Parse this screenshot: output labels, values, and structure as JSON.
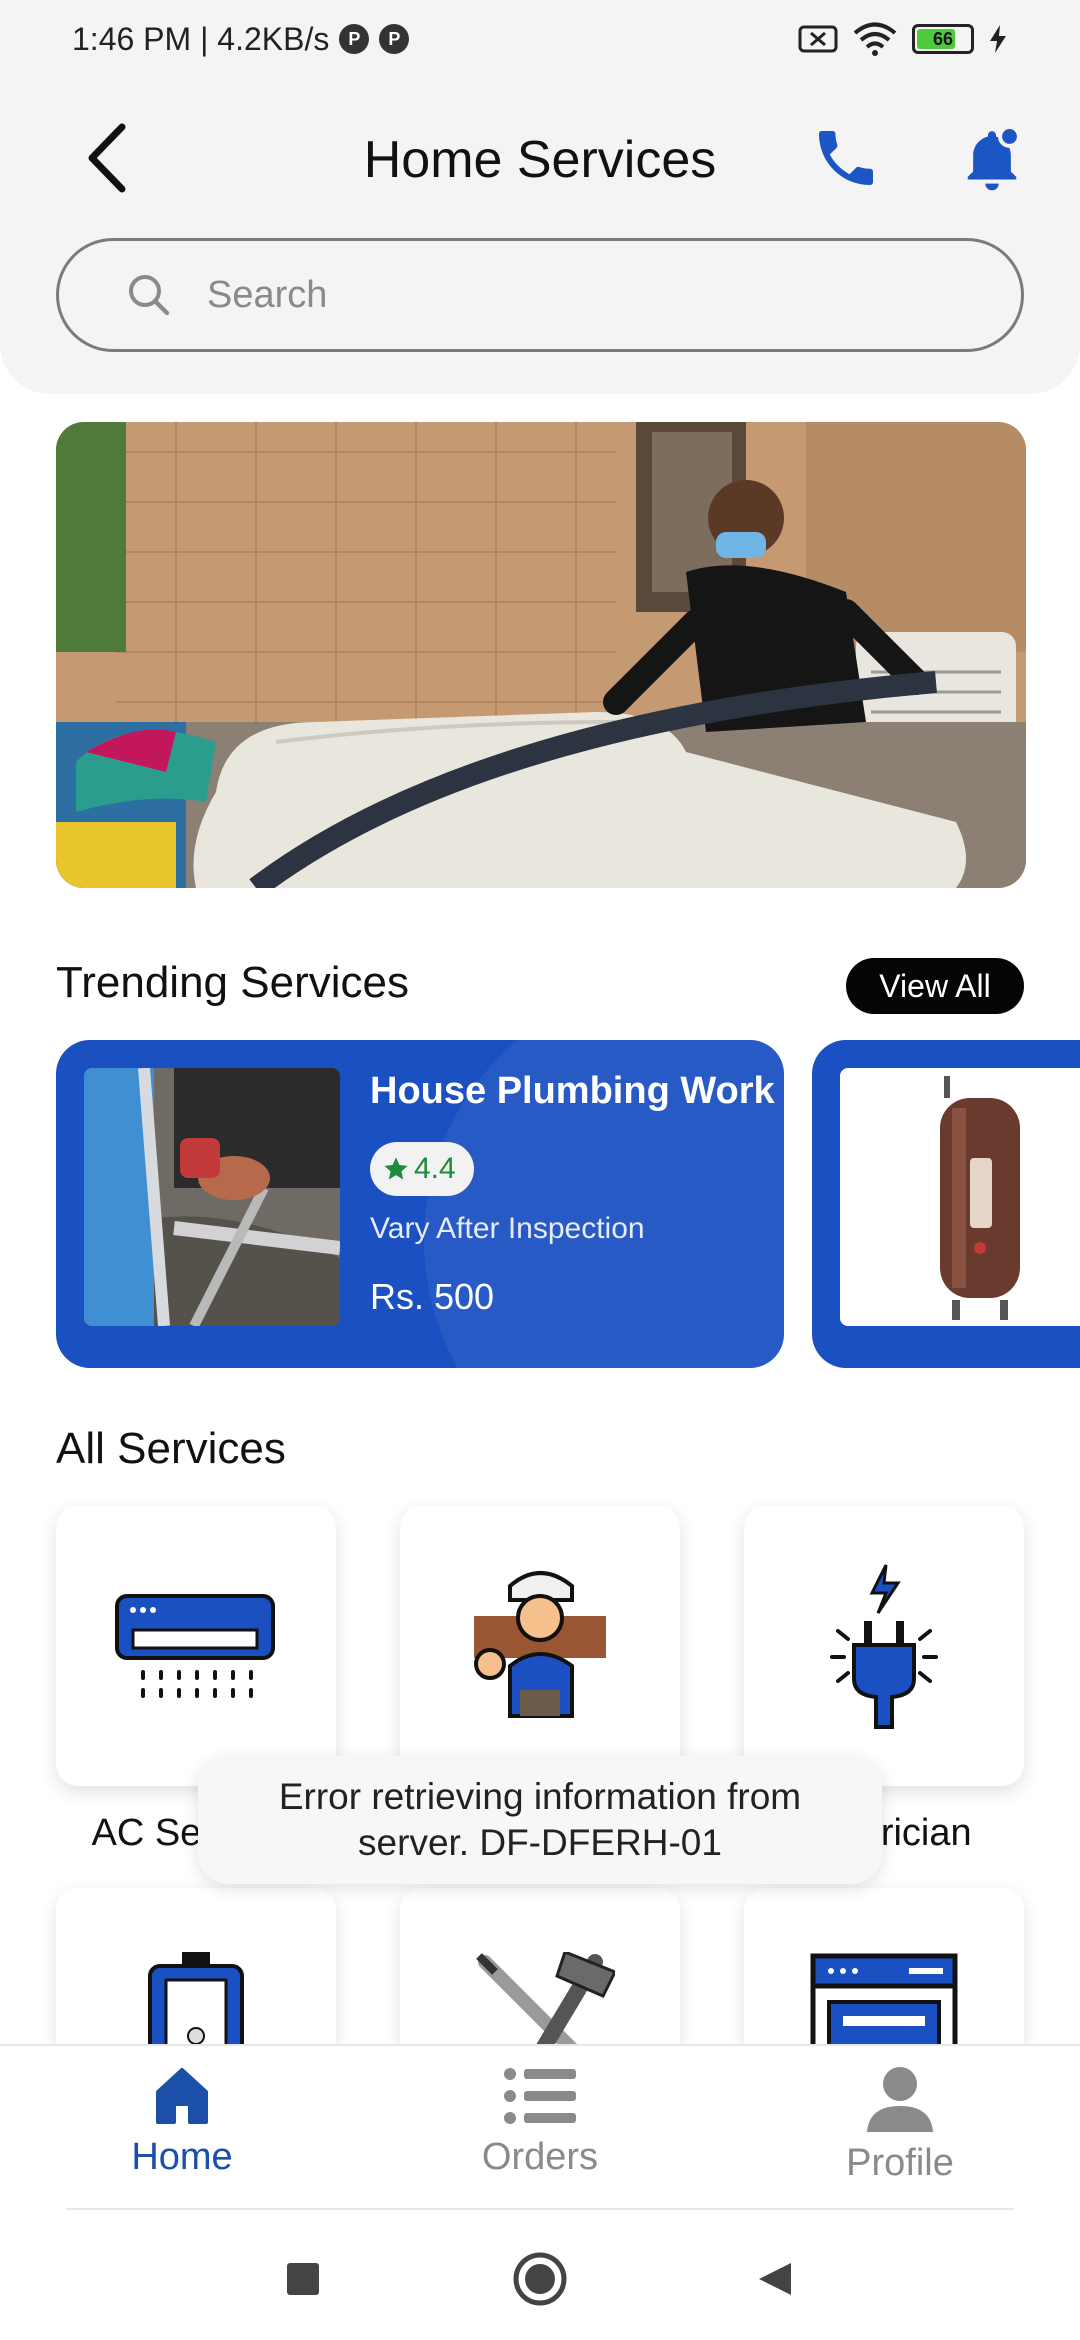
{
  "status_bar": {
    "time_speed": "1:46 PM | 4.2KB/s",
    "battery_level": "66"
  },
  "header": {
    "title": "Home Services",
    "icons": {
      "back": "back-arrow-icon",
      "phone": "phone-icon",
      "bell": "notification-bell-icon"
    }
  },
  "search": {
    "placeholder": "Search"
  },
  "trending": {
    "title": "Trending Services",
    "view_all_label": "View All",
    "cards": [
      {
        "name": "House Plumbing Work",
        "rating": "4.4",
        "subtitle": "Vary After Inspection",
        "price": "Rs. 500"
      }
    ]
  },
  "all_services": {
    "title": "All Services",
    "items": [
      {
        "label": "AC Services",
        "icon": "air-conditioner-icon"
      },
      {
        "label": "",
        "icon": "carpenter-icon"
      },
      {
        "label": "Electrician",
        "icon": "electric-plug-icon"
      },
      {
        "label": "",
        "icon": "water-heater-icon"
      },
      {
        "label": "",
        "icon": "tools-icon"
      },
      {
        "label": "",
        "icon": "appliance-icon"
      }
    ]
  },
  "toast": {
    "message": "Error retrieving information from server. DF-DFERH-01"
  },
  "bottom_nav": {
    "items": [
      {
        "label": "Home",
        "active": true
      },
      {
        "label": "Orders",
        "active": false
      },
      {
        "label": "Profile",
        "active": false
      }
    ]
  },
  "colors": {
    "accent": "#1a50c2",
    "nav_active": "#1b4fa8",
    "nav_inactive": "#8a8a8a"
  }
}
